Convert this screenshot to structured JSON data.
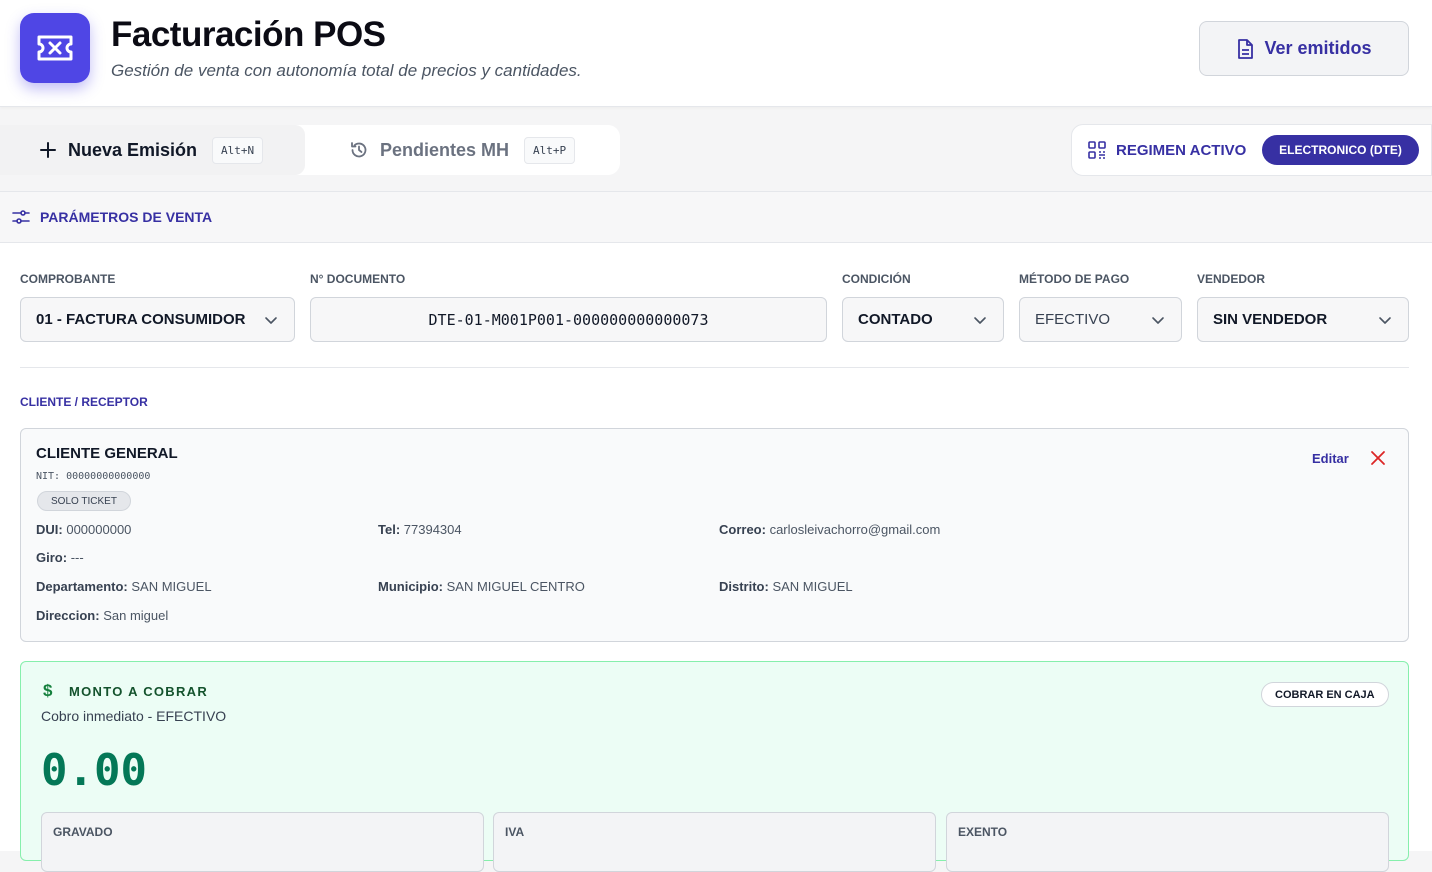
{
  "header": {
    "title": "Facturación POS",
    "subtitle": "Gestión de venta con autonomía total de precios y cantidades.",
    "emitidos_label": "Ver emitidos"
  },
  "tabs": [
    {
      "label": "Nueva Emisión",
      "shortcut": "Alt+N",
      "active": true
    },
    {
      "label": "Pendientes MH",
      "shortcut": "Alt+P",
      "active": false
    }
  ],
  "regimen": {
    "label": "REGIMEN ACTIVO",
    "value": "ELECTRONICO (DTE)"
  },
  "params": {
    "title": "PARÁMETROS DE VENTA",
    "comprobante": {
      "label": "COMPROBANTE",
      "value": "01 - FACTURA CONSUMIDOR"
    },
    "documento": {
      "label": "N° DOCUMENTO",
      "value": "DTE-01-M001P001-000000000000073"
    },
    "condicion": {
      "label": "CONDICIÓN",
      "value": "CONTADO"
    },
    "metodo": {
      "label": "MÉTODO DE PAGO",
      "value": "EFECTIVO"
    },
    "vendedor": {
      "label": "VENDEDOR",
      "value": "SIN VENDEDOR"
    }
  },
  "cliente": {
    "section_label": "CLIENTE / RECEPTOR",
    "name": "CLIENTE GENERAL",
    "nit": "NIT: 00000000000000",
    "tag": "SOLO TICKET",
    "edit_label": "Editar",
    "fields": {
      "dui": {
        "k": "DUI:",
        "v": "000000000"
      },
      "tel": {
        "k": "Tel:",
        "v": "77394304"
      },
      "correo": {
        "k": "Correo:",
        "v": "carlosleivachorro@gmail.com"
      },
      "giro": {
        "k": "Giro:",
        "v": "---"
      },
      "departamento": {
        "k": "Departamento:",
        "v": "SAN MIGUEL"
      },
      "municipio": {
        "k": "Municipio:",
        "v": "SAN MIGUEL CENTRO"
      },
      "distrito": {
        "k": "Distrito:",
        "v": "SAN MIGUEL"
      },
      "direccion": {
        "k": "Direccion:",
        "v": "San miguel"
      }
    }
  },
  "monto": {
    "icon": "$",
    "title": "MONTO A COBRAR",
    "subtitle": "Cobro inmediato - EFECTIVO",
    "button": "COBRAR EN CAJA",
    "amount": "0.00",
    "totals": [
      {
        "label": "GRAVADO"
      },
      {
        "label": "IVA"
      },
      {
        "label": "EXENTO"
      }
    ]
  },
  "colors": {
    "accent": "#3730a3",
    "brand": "#4f46e5",
    "success": "#047857",
    "danger": "#dc2626"
  }
}
